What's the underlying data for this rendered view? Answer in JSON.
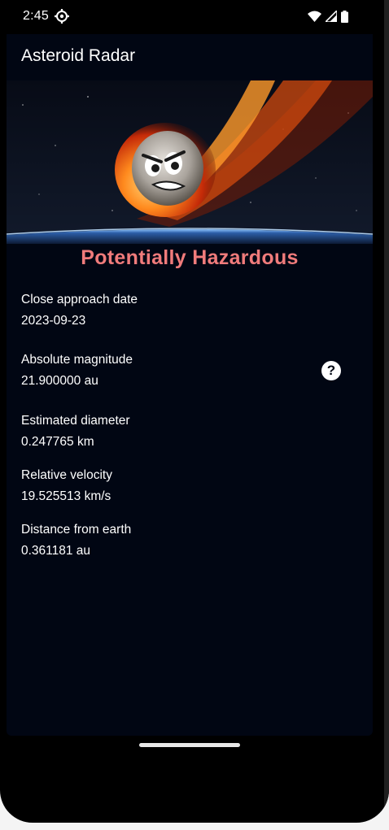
{
  "status_bar": {
    "time": "2:45",
    "icons": [
      "settings-gear-icon",
      "wifi-icon",
      "signal-icon",
      "battery-icon"
    ]
  },
  "app_bar": {
    "title": "Asteroid Radar"
  },
  "banner": {
    "image": "flaming-angry-asteroid-over-earth",
    "hazard_label": "Potentially Hazardous"
  },
  "details": [
    {
      "label": "Close approach date",
      "value": "2023-09-23"
    },
    {
      "label": "Absolute magnitude",
      "value": "21.900000 au"
    },
    {
      "label": "Estimated diameter",
      "value": "0.247765 km"
    },
    {
      "label": "Relative velocity",
      "value": "19.525513 km/s"
    },
    {
      "label": "Distance from earth",
      "value": "0.361181 au"
    }
  ],
  "help_button": {
    "glyph": "?",
    "icon": "help-circle-icon"
  },
  "colors": {
    "background": "#010613",
    "hazard_text": "#f07b7b",
    "text": "#ffffff"
  }
}
